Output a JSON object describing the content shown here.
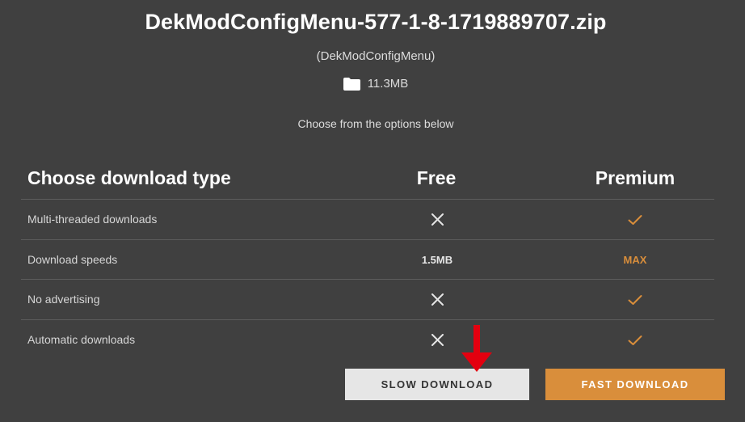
{
  "file": {
    "title": "DekModConfigMenu-577-1-8-1719889707.zip",
    "mod_name": "(DekModConfigMenu)",
    "size": "11.3MB"
  },
  "subtitle": "Choose from the options below",
  "table": {
    "headers": {
      "type": "Choose download type",
      "free": "Free",
      "premium": "Premium"
    },
    "rows": [
      {
        "label": "Multi-threaded downloads",
        "free": "cross",
        "premium": "check"
      },
      {
        "label": "Download speeds",
        "free": "1.5MB",
        "premium": "MAX"
      },
      {
        "label": "No advertising",
        "free": "cross",
        "premium": "check"
      },
      {
        "label": "Automatic downloads",
        "free": "cross",
        "premium": "check"
      }
    ]
  },
  "buttons": {
    "slow": "SLOW DOWNLOAD",
    "fast": "FAST DOWNLOAD"
  },
  "colors": {
    "background": "#404040",
    "accent": "#d98e3b",
    "annotation_arrow": "#e3000f"
  },
  "icons": {
    "size": "folder-icon",
    "free_unavailable": "cross-icon",
    "premium_available": "check-icon",
    "annotation": "red-arrow-down-icon"
  }
}
